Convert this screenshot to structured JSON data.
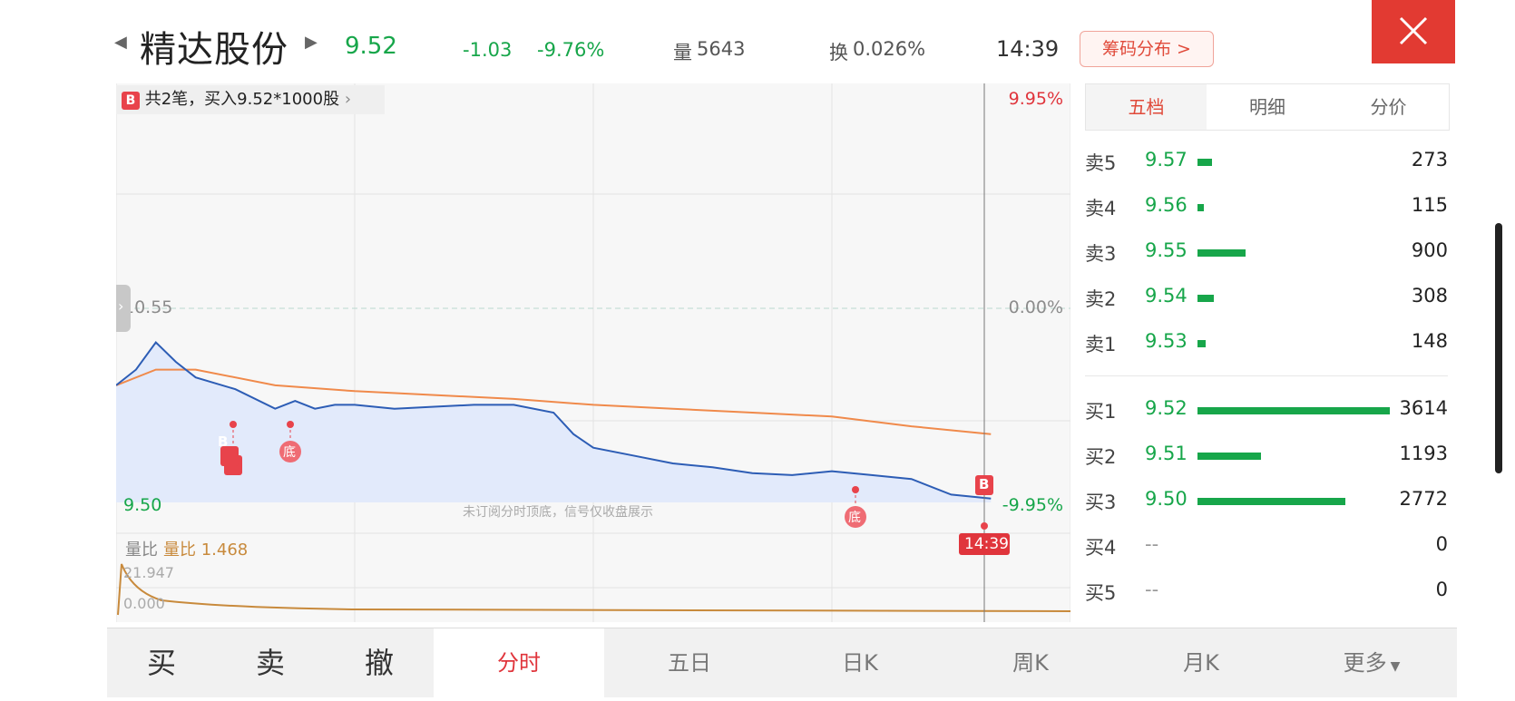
{
  "header": {
    "stock_name": "精达股份",
    "price": "9.52",
    "change": "-1.03",
    "change_pct": "-9.76%",
    "volume_label": "量",
    "volume": "5643",
    "turnover_label": "换",
    "turnover": "0.026%",
    "time": "14:39",
    "chip_button": "筹码分布 >"
  },
  "chart": {
    "trade_banner": "共2笔，买入9.52*1000股",
    "b_tag": "B",
    "axis": {
      "top_pct": "9.95%",
      "mid_price": "10.55",
      "mid_pct": "0.00%",
      "low_price": "9.50",
      "low_pct": "-9.95%"
    },
    "note": "未订阅分时顶底，信号仅收盘展示",
    "marker_bottom": "底",
    "marker_buy": "B",
    "crosshair_time": "14:39",
    "volume_ratio_label": "量比",
    "volume_ratio_value": "量比 1.468",
    "vr_top": "21.947",
    "vr_bottom": "0.000",
    "colors": {
      "price_line": "#2d5db5",
      "avg_line": "#f08a4b",
      "fill": "#e2eafb",
      "vr_line": "#c88a3c"
    }
  },
  "chart_data": {
    "type": "line",
    "title": "",
    "x_range": [
      "09:30",
      "15:00"
    ],
    "ylim": [
      9.5,
      11.6
    ],
    "prev_close": 10.55,
    "series": [
      {
        "name": "",
        "x_minutes": [
          0,
          5,
          10,
          15,
          20,
          30,
          40,
          45,
          50,
          55,
          60,
          70,
          80,
          90,
          100,
          110,
          115,
          120,
          130,
          140,
          150,
          160,
          170,
          180,
          190,
          200,
          210,
          220
        ],
        "values": [
          10.1,
          10.18,
          10.32,
          10.22,
          10.14,
          10.08,
          9.98,
          10.02,
          9.98,
          10.0,
          10.0,
          9.98,
          9.99,
          10.0,
          10.0,
          9.96,
          9.85,
          9.78,
          9.74,
          9.7,
          9.68,
          9.65,
          9.64,
          9.66,
          9.64,
          9.62,
          9.54,
          9.52
        ]
      },
      {
        "name": "",
        "x_minutes": [
          0,
          10,
          20,
          40,
          60,
          80,
          100,
          120,
          140,
          160,
          180,
          200,
          220
        ],
        "values": [
          10.1,
          10.18,
          10.18,
          10.1,
          10.07,
          10.05,
          10.03,
          10.0,
          9.98,
          9.96,
          9.94,
          9.89,
          9.85
        ]
      }
    ]
  },
  "order_book": {
    "tabs": [
      "五档",
      "明细",
      "分价"
    ],
    "asks": [
      {
        "label": "卖5",
        "price": "9.57",
        "vol": "273",
        "bar": 0.075
      },
      {
        "label": "卖4",
        "price": "9.56",
        "vol": "115",
        "bar": 0.032
      },
      {
        "label": "卖3",
        "price": "9.55",
        "vol": "900",
        "bar": 0.249
      },
      {
        "label": "卖2",
        "price": "9.54",
        "vol": "308",
        "bar": 0.085
      },
      {
        "label": "卖1",
        "price": "9.53",
        "vol": "148",
        "bar": 0.041
      }
    ],
    "bids": [
      {
        "label": "买1",
        "price": "9.52",
        "vol": "3614",
        "bar": 1.0
      },
      {
        "label": "买2",
        "price": "9.51",
        "vol": "1193",
        "bar": 0.33
      },
      {
        "label": "买3",
        "price": "9.50",
        "vol": "2772",
        "bar": 0.767
      },
      {
        "label": "买4",
        "price": "--",
        "vol": "0",
        "bar": 0
      },
      {
        "label": "买5",
        "price": "--",
        "vol": "0",
        "bar": 0
      }
    ]
  },
  "bottom": {
    "buy": "买",
    "sell": "卖",
    "cancel": "撤",
    "tabs": [
      "分时",
      "五日",
      "日K",
      "周K",
      "月K",
      "更多"
    ]
  }
}
